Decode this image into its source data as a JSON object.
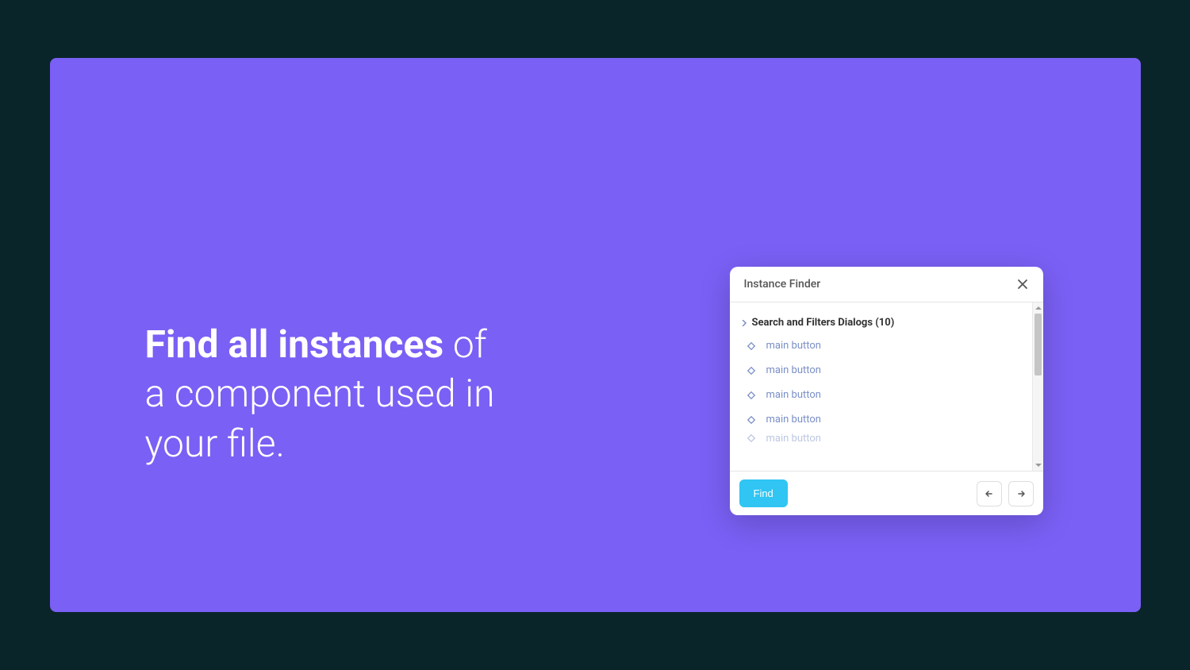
{
  "hero": {
    "bold": "Find all instances",
    "rest_line1": " of",
    "line2": "a component used in",
    "line3": "your file."
  },
  "dialog": {
    "title": "Instance Finder",
    "group_label": "Search and Filters Dialogs (10)",
    "items": [
      {
        "label": "main button"
      },
      {
        "label": "main button"
      },
      {
        "label": "main button"
      },
      {
        "label": "main button"
      },
      {
        "label": "main button"
      }
    ],
    "find_label": "Find"
  },
  "colors": {
    "accent": "#30c5f2",
    "background": "#7a60f5",
    "outer": "#0a2529",
    "instance_icon": "#7a8fc7"
  }
}
